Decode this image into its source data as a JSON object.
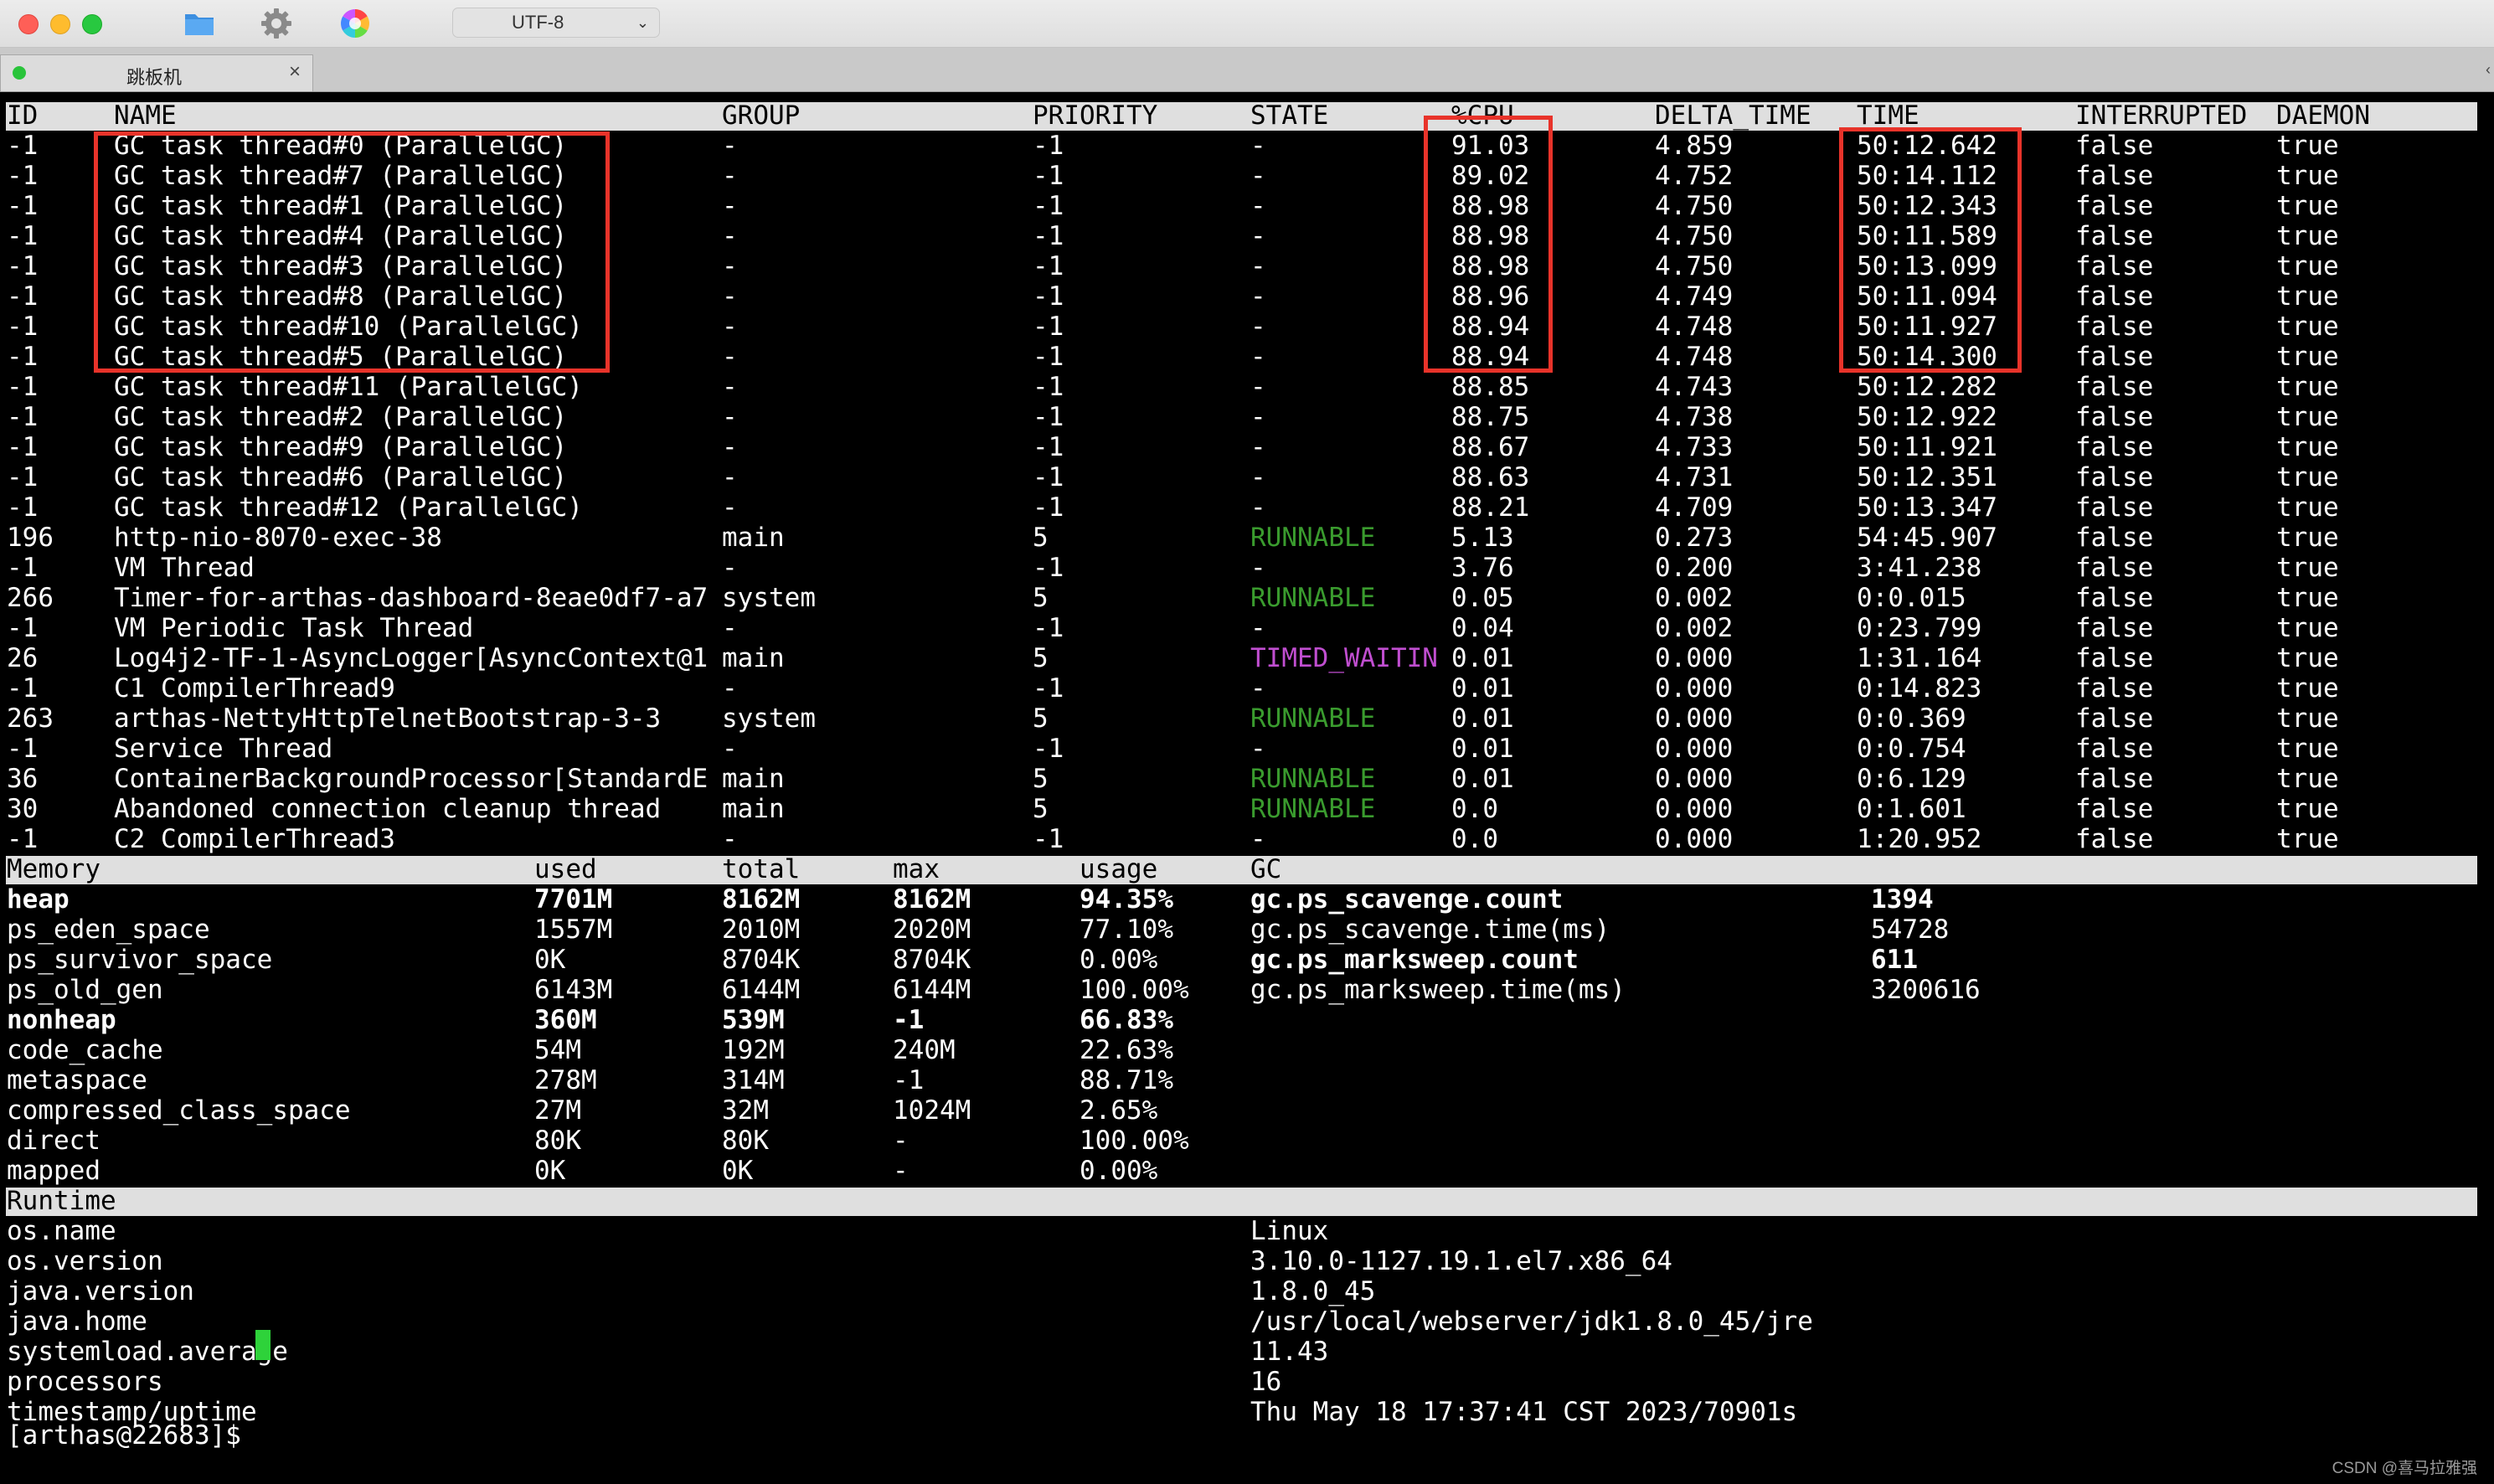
{
  "toolbar": {
    "encoding": "UTF-8",
    "icons": [
      "folder-icon",
      "gear-icon",
      "color-wheel-icon"
    ]
  },
  "tab": {
    "title": "跳板机",
    "close": "×"
  },
  "threads": {
    "headers": [
      "ID",
      "NAME",
      "GROUP",
      "PRIORITY",
      "STATE",
      "%CPU",
      "DELTA_TIME",
      "TIME",
      "INTERRUPTED",
      "DAEMON"
    ],
    "rows": [
      [
        "-1",
        "GC task thread#0 (ParallelGC)",
        "-",
        "-1",
        "-",
        "91.03",
        "4.859",
        "50:12.642",
        "false",
        "true"
      ],
      [
        "-1",
        "GC task thread#7 (ParallelGC)",
        "-",
        "-1",
        "-",
        "89.02",
        "4.752",
        "50:14.112",
        "false",
        "true"
      ],
      [
        "-1",
        "GC task thread#1 (ParallelGC)",
        "-",
        "-1",
        "-",
        "88.98",
        "4.750",
        "50:12.343",
        "false",
        "true"
      ],
      [
        "-1",
        "GC task thread#4 (ParallelGC)",
        "-",
        "-1",
        "-",
        "88.98",
        "4.750",
        "50:11.589",
        "false",
        "true"
      ],
      [
        "-1",
        "GC task thread#3 (ParallelGC)",
        "-",
        "-1",
        "-",
        "88.98",
        "4.750",
        "50:13.099",
        "false",
        "true"
      ],
      [
        "-1",
        "GC task thread#8 (ParallelGC)",
        "-",
        "-1",
        "-",
        "88.96",
        "4.749",
        "50:11.094",
        "false",
        "true"
      ],
      [
        "-1",
        "GC task thread#10 (ParallelGC)",
        "-",
        "-1",
        "-",
        "88.94",
        "4.748",
        "50:11.927",
        "false",
        "true"
      ],
      [
        "-1",
        "GC task thread#5 (ParallelGC)",
        "-",
        "-1",
        "-",
        "88.94",
        "4.748",
        "50:14.300",
        "false",
        "true"
      ],
      [
        "-1",
        "GC task thread#11 (ParallelGC)",
        "-",
        "-1",
        "-",
        "88.85",
        "4.743",
        "50:12.282",
        "false",
        "true"
      ],
      [
        "-1",
        "GC task thread#2 (ParallelGC)",
        "-",
        "-1",
        "-",
        "88.75",
        "4.738",
        "50:12.922",
        "false",
        "true"
      ],
      [
        "-1",
        "GC task thread#9 (ParallelGC)",
        "-",
        "-1",
        "-",
        "88.67",
        "4.733",
        "50:11.921",
        "false",
        "true"
      ],
      [
        "-1",
        "GC task thread#6 (ParallelGC)",
        "-",
        "-1",
        "-",
        "88.63",
        "4.731",
        "50:12.351",
        "false",
        "true"
      ],
      [
        "-1",
        "GC task thread#12 (ParallelGC)",
        "-",
        "-1",
        "-",
        "88.21",
        "4.709",
        "50:13.347",
        "false",
        "true"
      ],
      [
        "196",
        "http-nio-8070-exec-38",
        "main",
        "5",
        "RUNNABLE",
        "5.13",
        "0.273",
        "54:45.907",
        "false",
        "true"
      ],
      [
        "-1",
        "VM Thread",
        "-",
        "-1",
        "-",
        "3.76",
        "0.200",
        "3:41.238",
        "false",
        "true"
      ],
      [
        "266",
        "Timer-for-arthas-dashboard-8eae0df7-a7",
        "system",
        "5",
        "RUNNABLE",
        "0.05",
        "0.002",
        "0:0.015",
        "false",
        "true"
      ],
      [
        "-1",
        "VM Periodic Task Thread",
        "-",
        "-1",
        "-",
        "0.04",
        "0.002",
        "0:23.799",
        "false",
        "true"
      ],
      [
        "26",
        "Log4j2-TF-1-AsyncLogger[AsyncContext@1",
        "main",
        "5",
        "TIMED_WAITIN",
        "0.01",
        "0.000",
        "1:31.164",
        "false",
        "true"
      ],
      [
        "-1",
        "C1 CompilerThread9",
        "-",
        "-1",
        "-",
        "0.01",
        "0.000",
        "0:14.823",
        "false",
        "true"
      ],
      [
        "263",
        "arthas-NettyHttpTelnetBootstrap-3-3",
        "system",
        "5",
        "RUNNABLE",
        "0.01",
        "0.000",
        "0:0.369",
        "false",
        "true"
      ],
      [
        "-1",
        "Service Thread",
        "-",
        "-1",
        "-",
        "0.01",
        "0.000",
        "0:0.754",
        "false",
        "true"
      ],
      [
        "36",
        "ContainerBackgroundProcessor[StandardE",
        "main",
        "5",
        "RUNNABLE",
        "0.01",
        "0.000",
        "0:6.129",
        "false",
        "true"
      ],
      [
        "30",
        "Abandoned connection cleanup thread",
        "main",
        "5",
        "RUNNABLE",
        "0.0",
        "0.000",
        "0:1.601",
        "false",
        "true"
      ],
      [
        "-1",
        "C2 CompilerThread3",
        "-",
        "-1",
        "-",
        "0.0",
        "0.000",
        "1:20.952",
        "false",
        "true"
      ]
    ]
  },
  "memory": {
    "headers": [
      "Memory",
      "used",
      "total",
      "max",
      "usage",
      "GC"
    ],
    "rows": [
      {
        "name": "heap",
        "used": "7701M",
        "total": "8162M",
        "max": "8162M",
        "usage": "94.35%",
        "bold": true,
        "gc_name": "gc.ps_scavenge.count",
        "gc_value": "1394",
        "gc_bold": true
      },
      {
        "name": "ps_eden_space",
        "used": "1557M",
        "total": "2010M",
        "max": "2020M",
        "usage": "77.10%",
        "bold": false,
        "gc_name": "gc.ps_scavenge.time(ms)",
        "gc_value": "54728",
        "gc_bold": false
      },
      {
        "name": "ps_survivor_space",
        "used": "0K",
        "total": "8704K",
        "max": "8704K",
        "usage": "0.00%",
        "bold": false,
        "gc_name": "gc.ps_marksweep.count",
        "gc_value": "611",
        "gc_bold": true
      },
      {
        "name": "ps_old_gen",
        "used": "6143M",
        "total": "6144M",
        "max": "6144M",
        "usage": "100.00%",
        "bold": false,
        "gc_name": "gc.ps_marksweep.time(ms)",
        "gc_value": "3200616",
        "gc_bold": false
      },
      {
        "name": "nonheap",
        "used": "360M",
        "total": "539M",
        "max": "-1",
        "usage": "66.83%",
        "bold": true,
        "gc_name": "",
        "gc_value": "",
        "gc_bold": false
      },
      {
        "name": "code_cache",
        "used": "54M",
        "total": "192M",
        "max": "240M",
        "usage": "22.63%",
        "bold": false,
        "gc_name": "",
        "gc_value": "",
        "gc_bold": false
      },
      {
        "name": "metaspace",
        "used": "278M",
        "total": "314M",
        "max": "-1",
        "usage": "88.71%",
        "bold": false,
        "gc_name": "",
        "gc_value": "",
        "gc_bold": false
      },
      {
        "name": "compressed_class_space",
        "used": "27M",
        "total": "32M",
        "max": "1024M",
        "usage": "2.65%",
        "bold": false,
        "gc_name": "",
        "gc_value": "",
        "gc_bold": false
      },
      {
        "name": "direct",
        "used": "80K",
        "total": "80K",
        "max": "-",
        "usage": "100.00%",
        "bold": false,
        "gc_name": "",
        "gc_value": "",
        "gc_bold": false
      },
      {
        "name": "mapped",
        "used": "0K",
        "total": "0K",
        "max": "-",
        "usage": "0.00%",
        "bold": false,
        "gc_name": "",
        "gc_value": "",
        "gc_bold": false
      }
    ]
  },
  "runtime": {
    "header": "Runtime",
    "rows": [
      [
        "os.name",
        "Linux"
      ],
      [
        "os.version",
        "3.10.0-1127.19.1.el7.x86_64"
      ],
      [
        "java.version",
        "1.8.0_45"
      ],
      [
        "java.home",
        "/usr/local/webserver/jdk1.8.0_45/jre"
      ],
      [
        "systemload.average",
        "11.43"
      ],
      [
        "processors",
        "16"
      ],
      [
        "timestamp/uptime",
        "Thu May 18 17:37:41 CST 2023/70901s"
      ]
    ]
  },
  "prompt": "[arthas@22683]$",
  "watermark": "CSDN @喜马拉雅强",
  "colors": {
    "highlight": "#e8332a",
    "runnable": "#3a9b2e",
    "timed_waiting": "#c04ed0",
    "cursor": "#2ed23a"
  }
}
